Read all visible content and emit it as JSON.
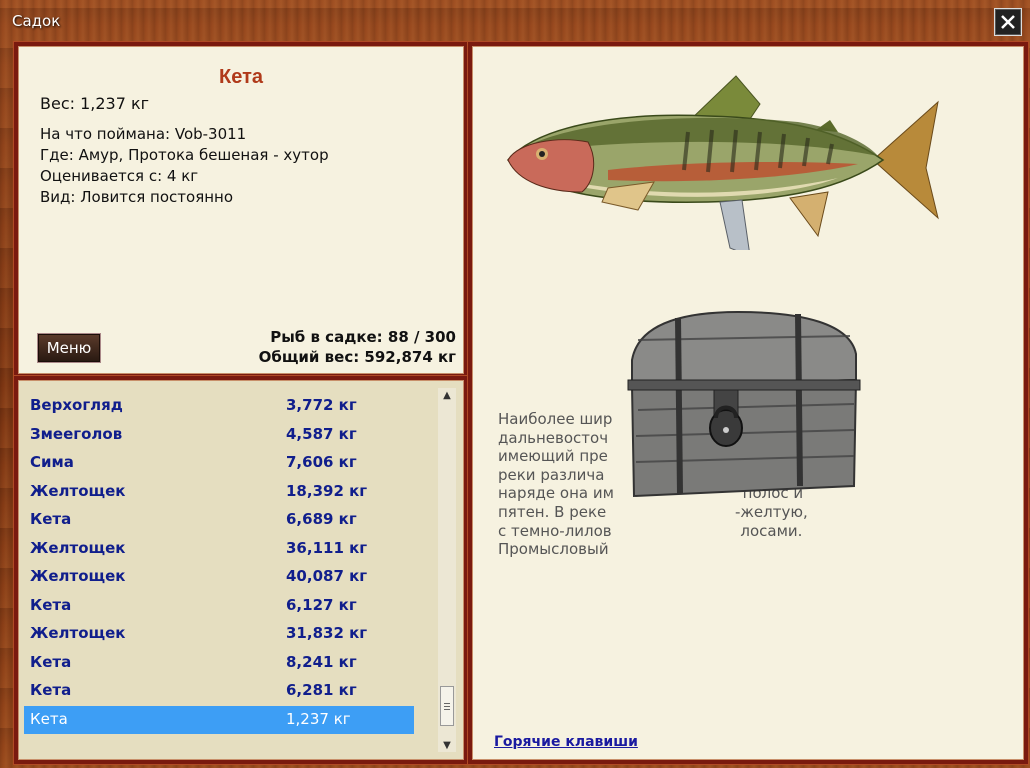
{
  "window": {
    "title": "Садок"
  },
  "info": {
    "fish_name": "Кета",
    "weight_line": "Вес: 1,237 кг",
    "caught_on": "На что поймана: Vob-3011",
    "location": "Где: Амур, Протока бешеная - хутор",
    "valued_from": "Оценивается с: 4 кг",
    "type": "Вид: Ловится постоянно",
    "menu_label": "Меню",
    "fish_count": "Рыб в садке: 88 / 300",
    "total_weight": "Общий вес: 592,874 кг"
  },
  "catch_list": [
    {
      "name": "Верхогляд",
      "weight": "3,772 кг"
    },
    {
      "name": "Змееголов",
      "weight": "4,587 кг"
    },
    {
      "name": "Сима",
      "weight": "7,606 кг"
    },
    {
      "name": "Желтощек",
      "weight": "18,392 кг"
    },
    {
      "name": "Кета",
      "weight": "6,689 кг"
    },
    {
      "name": "Желтощек",
      "weight": "36,111 кг"
    },
    {
      "name": "Желтощек",
      "weight": "40,087 кг"
    },
    {
      "name": "Кета",
      "weight": "6,127 кг"
    },
    {
      "name": "Желтощек",
      "weight": "31,832 кг"
    },
    {
      "name": "Кета",
      "weight": "8,241 кг"
    },
    {
      "name": "Кета",
      "weight": "6,281 кг"
    },
    {
      "name": "Кета",
      "weight": "1,237 кг",
      "selected": true
    }
  ],
  "detail": {
    "description_lines": [
      "Наиболее шир                            овый вид",
      "дальневосточ                            е",
      "имеющий пре                             захода в",
      "реки различа                            морском",
      "наряде она им                           полос и",
      "пятен. В реке                           -желтую,",
      "с темно-лилов                           лосами.",
      "Промысловый"
    ],
    "hotkeys_label": "Горячие клавиши"
  },
  "colors": {
    "frame": "#7a1a0f",
    "panel_bg": "#f6f2e0",
    "list_bg": "#e5dec0",
    "list_text": "#101e8c",
    "selected_bg": "#3d9ef5",
    "fish_name": "#b03a1a"
  },
  "icons": {
    "close": "close-icon",
    "fish": "fish-image",
    "chest": "chest-image"
  }
}
